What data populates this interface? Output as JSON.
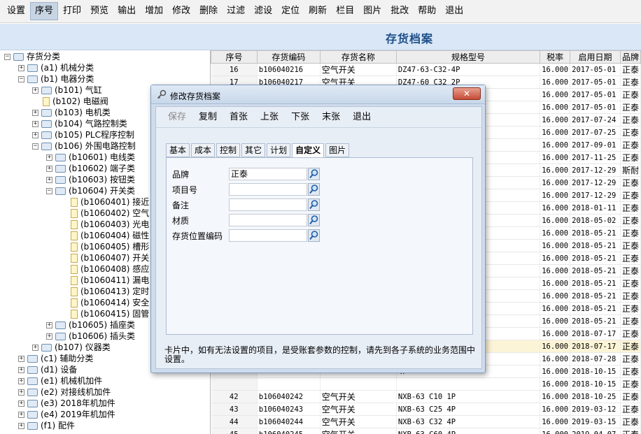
{
  "menu": [
    "设置",
    "序号",
    "打印",
    "预览",
    "输出",
    "增加",
    "修改",
    "删除",
    "过滤",
    "滤设",
    "定位",
    "刷新",
    "栏目",
    "图片",
    "批改",
    "帮助",
    "退出"
  ],
  "title": "存货档案",
  "tree": [
    {
      "label": "存货分类",
      "level": 0,
      "expander": "−",
      "icon": "folder"
    },
    {
      "label": "(a1) 机械分类",
      "level": 1,
      "expander": "+",
      "icon": "folder"
    },
    {
      "label": "(b1) 电器分类",
      "level": 1,
      "expander": "−",
      "icon": "folder"
    },
    {
      "label": "(b101) 气缸",
      "level": 2,
      "expander": "+",
      "icon": "folder"
    },
    {
      "label": "(b102) 电磁阀",
      "level": 2,
      "expander": "",
      "icon": "doc"
    },
    {
      "label": "(b103) 电机类",
      "level": 2,
      "expander": "+",
      "icon": "folder"
    },
    {
      "label": "(b104) 气路控制类",
      "level": 2,
      "expander": "+",
      "icon": "folder"
    },
    {
      "label": "(b105) PLC程序控制",
      "level": 2,
      "expander": "+",
      "icon": "folder"
    },
    {
      "label": "(b106) 外围电路控制",
      "level": 2,
      "expander": "−",
      "icon": "folder"
    },
    {
      "label": "(b10601) 电线类",
      "level": 3,
      "expander": "+",
      "icon": "folder"
    },
    {
      "label": "(b10602) 端子类",
      "level": 3,
      "expander": "+",
      "icon": "folder"
    },
    {
      "label": "(b10603) 按钮类",
      "level": 3,
      "expander": "+",
      "icon": "folder"
    },
    {
      "label": "(b10604) 开关类",
      "level": 3,
      "expander": "−",
      "icon": "folder"
    },
    {
      "label": "(b1060401) 接近",
      "level": 4,
      "expander": "",
      "icon": "doc"
    },
    {
      "label": "(b1060402) 空气",
      "level": 4,
      "expander": "",
      "icon": "doc"
    },
    {
      "label": "(b1060403) 光电",
      "level": 4,
      "expander": "",
      "icon": "doc"
    },
    {
      "label": "(b1060404) 磁性",
      "level": 4,
      "expander": "",
      "icon": "doc"
    },
    {
      "label": "(b1060405) 槽形",
      "level": 4,
      "expander": "",
      "icon": "doc"
    },
    {
      "label": "(b1060407) 开关",
      "level": 4,
      "expander": "",
      "icon": "doc"
    },
    {
      "label": "(b1060408) 感应",
      "level": 4,
      "expander": "",
      "icon": "doc"
    },
    {
      "label": "(b1060411) 漏电",
      "level": 4,
      "expander": "",
      "icon": "doc"
    },
    {
      "label": "(b1060413) 定时",
      "level": 4,
      "expander": "",
      "icon": "doc"
    },
    {
      "label": "(b1060414) 安全",
      "level": 4,
      "expander": "",
      "icon": "doc"
    },
    {
      "label": "(b1060415) 固管",
      "level": 4,
      "expander": "",
      "icon": "doc"
    },
    {
      "label": "(b10605) 插座类",
      "level": 3,
      "expander": "+",
      "icon": "folder"
    },
    {
      "label": "(b10606) 插头类",
      "level": 3,
      "expander": "+",
      "icon": "folder"
    },
    {
      "label": "(b107) 仪器类",
      "level": 2,
      "expander": "+",
      "icon": "folder"
    },
    {
      "label": "(c1) 辅助分类",
      "level": 1,
      "expander": "+",
      "icon": "folder"
    },
    {
      "label": "(d1) 设备",
      "level": 1,
      "expander": "+",
      "icon": "folder"
    },
    {
      "label": "(e1) 机械机加件",
      "level": 1,
      "expander": "+",
      "icon": "folder"
    },
    {
      "label": "(e2) 对接线机加件",
      "level": 1,
      "expander": "+",
      "icon": "folder"
    },
    {
      "label": "(e3) 2018年机加件",
      "level": 1,
      "expander": "+",
      "icon": "folder"
    },
    {
      "label": "(e4) 2019年机加件",
      "level": 1,
      "expander": "+",
      "icon": "folder"
    },
    {
      "label": "(f1) 配件",
      "level": 1,
      "expander": "+",
      "icon": "folder"
    }
  ],
  "grid": {
    "columns": [
      "序号",
      "存货编码",
      "存货名称",
      "规格型号",
      "税率",
      "启用日期",
      "品牌"
    ],
    "rows": [
      [
        "16",
        "b106040216",
        "空气开关",
        "DZ47-63-C32-4P",
        "16.000",
        "2017-05-01",
        "正泰"
      ],
      [
        "17",
        "b106040217",
        "空气开关",
        "DZ47-60 C32 2P",
        "16.000",
        "2017-05-01",
        "正泰"
      ],
      [
        "",
        "",
        "",
        "",
        "16.000",
        "2017-05-01",
        "正泰"
      ],
      [
        "",
        "",
        "",
        "",
        "16.000",
        "2017-05-01",
        "正泰"
      ],
      [
        "",
        "",
        "",
        "",
        "16.000",
        "2017-07-24",
        "正泰"
      ],
      [
        "",
        "",
        "",
        "",
        "16.000",
        "2017-07-25",
        "正泰"
      ],
      [
        "",
        "",
        "",
        "",
        "16.000",
        "2017-09-01",
        "正泰"
      ],
      [
        "",
        "",
        "",
        "",
        "16.000",
        "2017-11-25",
        "正泰"
      ],
      [
        "",
        "",
        "",
        "",
        "16.000",
        "2017-12-29",
        "斯耐"
      ],
      [
        "",
        "",
        "",
        "",
        "16.000",
        "2017-12-29",
        "正泰"
      ],
      [
        "",
        "",
        "",
        "",
        "16.000",
        "2017-12-29",
        "正泰"
      ],
      [
        "",
        "",
        "",
        "",
        "16.000",
        "2018-01-11",
        "正泰"
      ],
      [
        "",
        "",
        "",
        "",
        "16.000",
        "2018-05-02",
        "正泰"
      ],
      [
        "",
        "",
        "",
        "",
        "16.000",
        "2018-05-21",
        "正泰"
      ],
      [
        "",
        "",
        "",
        "",
        "16.000",
        "2018-05-21",
        "正泰"
      ],
      [
        "",
        "",
        "",
        "",
        "16.000",
        "2018-05-21",
        "正泰"
      ],
      [
        "",
        "",
        "",
        "",
        "16.000",
        "2018-05-21",
        "正泰"
      ],
      [
        "",
        "",
        "",
        "",
        "16.000",
        "2018-05-21",
        "正泰"
      ],
      [
        "",
        "",
        "",
        "",
        "16.000",
        "2018-05-21",
        "正泰"
      ],
      [
        "",
        "",
        "",
        "",
        "16.000",
        "2018-05-21",
        "正泰"
      ],
      [
        "",
        "",
        "",
        "",
        "16.000",
        "2018-05-21",
        "正泰"
      ],
      [
        "",
        "",
        "",
        "",
        "16.000",
        "2018-07-17",
        "正泰"
      ],
      [
        "",
        "",
        "",
        "",
        "16.000",
        "2018-07-17",
        "正泰"
      ],
      [
        "",
        "",
        "",
        "",
        "16.000",
        "2018-07-28",
        "正泰"
      ],
      [
        "",
        "",
        "",
        "4P",
        "16.000",
        "2018-10-15",
        "正泰"
      ],
      [
        "",
        "",
        "",
        "",
        "16.000",
        "2018-10-15",
        "正泰"
      ],
      [
        "42",
        "b106040242",
        "空气开关",
        "NXB-63 C10 1P",
        "16.000",
        "2018-10-25",
        "正泰"
      ],
      [
        "43",
        "b106040243",
        "空气开关",
        "NXB-63 C25 4P",
        "16.000",
        "2019-03-12",
        "正泰"
      ],
      [
        "44",
        "b106040244",
        "空气开关",
        "NXB-63 C32 4P",
        "16.000",
        "2019-03-15",
        "正泰"
      ],
      [
        "45",
        "b106040245",
        "空气开关",
        "NXB-63 C60 4P",
        "16.000",
        "2019-04-07",
        "正泰"
      ],
      [
        "46",
        "b106040246",
        "空气开关",
        "NXB-63 C32 2P",
        "13.000",
        "2019-09-09",
        "正泰"
      ]
    ],
    "highlight_row": 22
  },
  "dialog": {
    "title": "修改存货档案",
    "close_label": "✕",
    "toolbar": [
      "保存",
      "复制",
      "首张",
      "上张",
      "下张",
      "末张",
      "退出"
    ],
    "tabs": [
      "基本",
      "成本",
      "控制",
      "其它",
      "计划",
      "自定义",
      "图片"
    ],
    "active_tab": "自定义",
    "fields": [
      {
        "label": "品牌",
        "value": "正泰"
      },
      {
        "label": "项目号",
        "value": ""
      },
      {
        "label": "备注",
        "value": ""
      },
      {
        "label": "材质",
        "value": ""
      },
      {
        "label": "存货位置编码",
        "value": ""
      }
    ],
    "note": "卡片中，如有无法设置的项目，是受账套参数的控制，请先到各子系统的业务范围中设置。"
  }
}
